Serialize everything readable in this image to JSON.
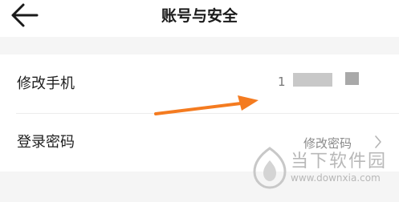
{
  "header": {
    "title": "账号与安全",
    "back_icon": "back-arrow-icon"
  },
  "rows": [
    {
      "label": "修改手机",
      "phone_prefix": "1",
      "phone_redacted": true
    },
    {
      "label": "登录密码",
      "value": "修改密码",
      "chevron_icon": "chevron-right-icon"
    }
  ],
  "annotation": {
    "arrow_color": "#f47b20"
  },
  "watermark": {
    "name": "当下软件园",
    "url": "www.downxia.com"
  },
  "colors": {
    "background": "#f5f5f5",
    "card": "#ffffff",
    "text": "#1f1f1f",
    "secondary_text": "#8a8a8a"
  }
}
